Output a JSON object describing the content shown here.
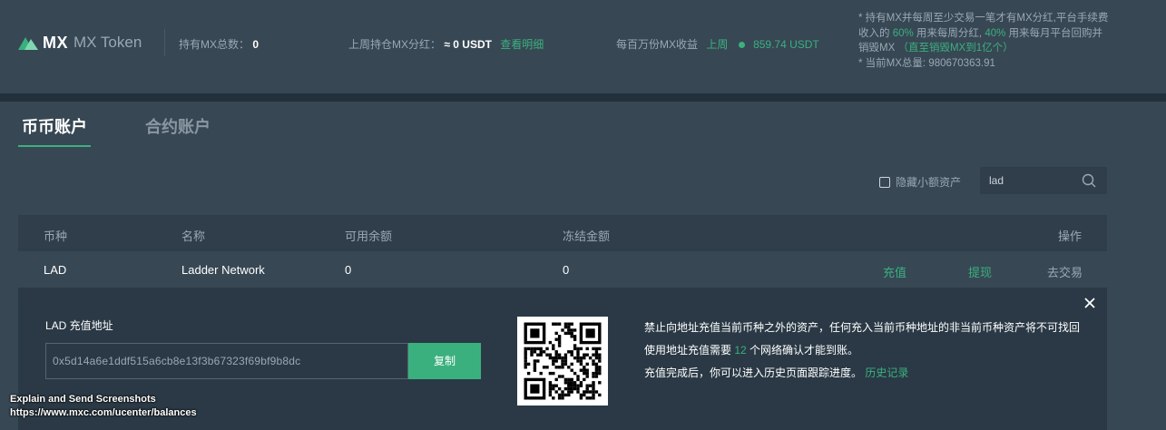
{
  "header": {
    "logo_mx": "MX",
    "logo_name": "MX Token",
    "hold_label": "持有MX总数：",
    "hold_value": "0",
    "dividend_label": "上周持仓MX分红：",
    "dividend_value": "≈ 0 USDT",
    "dividend_link": "查看明细",
    "earn_label": "每百万份MX收益",
    "earn_period": "上周",
    "earn_value": "859.74 USDT",
    "notes": {
      "line1_a": "* 持有MX并每周至少交易一笔才有MX分红,平台手续费收入的 ",
      "pct1": "60%",
      "line1_b": " 用来每周分红, ",
      "pct2": "40%",
      "line1_c": " 用来每月平台回购并销毁MX ",
      "burn_note": "（直至销毁MX到1亿个）",
      "line2": "* 当前MX总量: 980670363.91"
    }
  },
  "tabs": [
    {
      "label": "币币账户"
    },
    {
      "label": "合约账户"
    }
  ],
  "filter": {
    "hide_small_label": "隐藏小额资产",
    "search_value": "lad"
  },
  "table": {
    "columns": [
      "币种",
      "名称",
      "可用余额",
      "冻结金额",
      "操作"
    ],
    "rows": [
      {
        "coin": "LAD",
        "name": "Ladder Network",
        "available": "0",
        "frozen": "0",
        "actions": [
          "充值",
          "提现",
          "去交易"
        ]
      }
    ]
  },
  "deposit": {
    "label": "LAD 充值地址",
    "address": "0x5d14a6e1ddf515a6cb8e13f3b67323f69bf9b8dc",
    "copy_label": "复制",
    "tip1": "禁止向地址充值当前币种之外的资产，任何充入当前币种地址的非当前币种资产将不可找回",
    "tip2_a": "使用地址充值需要 ",
    "tip2_num": "12",
    "tip2_b": " 个网络确认才能到账。",
    "tip3_a": "充值完成后，你可以进入历史页面跟踪进度。 ",
    "tip3_link": "历史记录"
  },
  "overlay": {
    "line1": "Explain and Send Screenshots",
    "line2": "https://www.mxc.com/ucenter/balances"
  },
  "colors": {
    "accent": "#3bb07f",
    "background": "#374754",
    "panel": "#2a3945"
  }
}
